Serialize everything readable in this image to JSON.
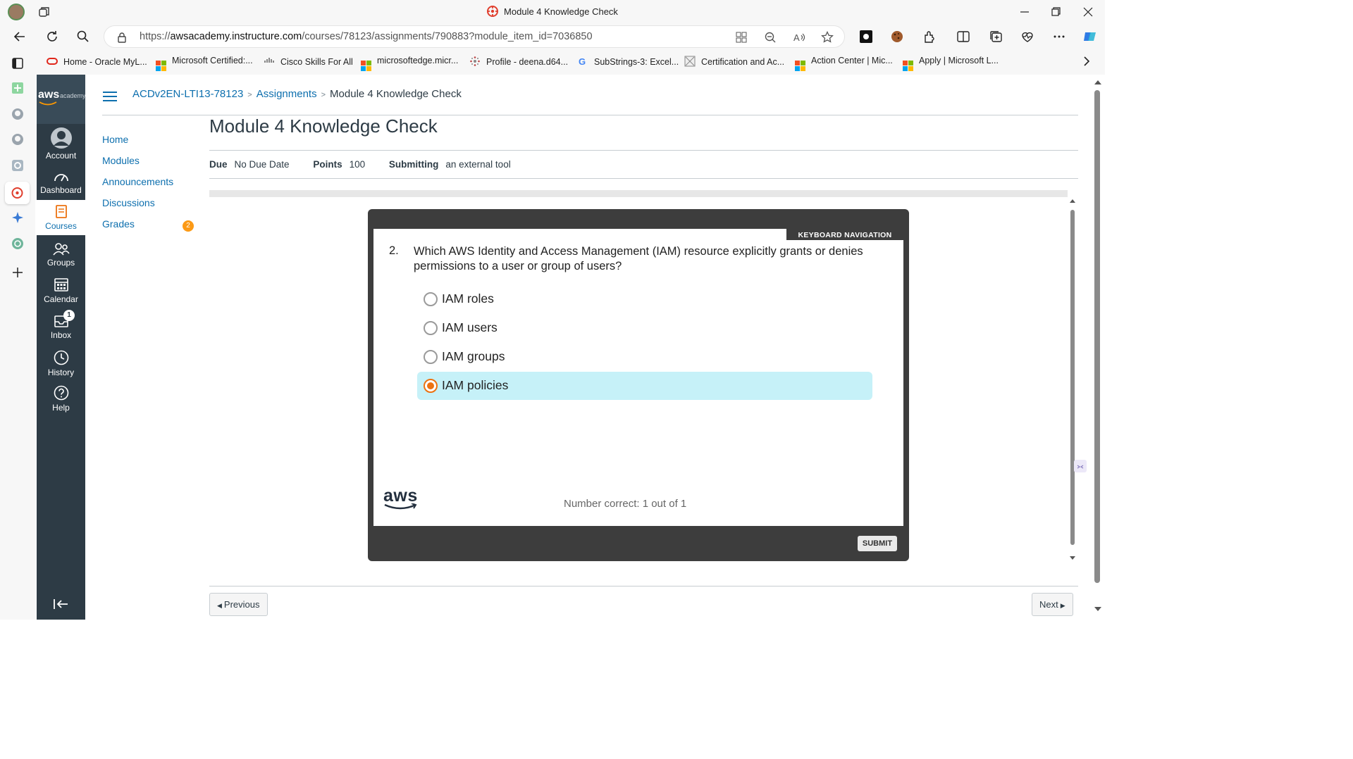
{
  "browser": {
    "window_title": "Module 4 Knowledge Check",
    "url_scheme": "https://",
    "url_host": "awsacademy.instructure.com",
    "url_path": "/courses/78123/assignments/790883?module_item_id=7036850",
    "bookmarks": [
      {
        "label": "Home - Oracle MyL...",
        "icon": "oracle-icon"
      },
      {
        "label": "Microsoft Certified:...",
        "icon": "microsoft-icon"
      },
      {
        "label": "Cisco Skills For All",
        "icon": "cisco-icon"
      },
      {
        "label": "microsoftedge.micr...",
        "icon": "microsoft-icon"
      },
      {
        "label": "Profile - deena.d64...",
        "icon": "profile-icon"
      },
      {
        "label": "SubStrings-3: Excel...",
        "icon": "google-icon"
      },
      {
        "label": "Certification and Ac...",
        "icon": "certification-icon"
      },
      {
        "label": "Action Center | Mic...",
        "icon": "microsoft-icon"
      },
      {
        "label": "Apply | Microsoft L...",
        "icon": "microsoft-icon"
      }
    ]
  },
  "global_nav": {
    "logo_text": "aws",
    "logo_sub": "academy",
    "items": [
      {
        "label": "Account",
        "icon": "account-icon"
      },
      {
        "label": "Dashboard",
        "icon": "dashboard-icon"
      },
      {
        "label": "Courses",
        "icon": "courses-icon",
        "active": true
      },
      {
        "label": "Groups",
        "icon": "groups-icon"
      },
      {
        "label": "Calendar",
        "icon": "calendar-icon"
      },
      {
        "label": "Inbox",
        "icon": "inbox-icon",
        "badge": "1"
      },
      {
        "label": "History",
        "icon": "history-icon"
      },
      {
        "label": "Help",
        "icon": "help-icon"
      }
    ]
  },
  "breadcrumb": {
    "course": "ACDv2EN-LTI13-78123",
    "section": "Assignments",
    "current": "Module 4 Knowledge Check"
  },
  "course_nav": {
    "items": [
      "Home",
      "Modules",
      "Announcements",
      "Discussions",
      "Grades"
    ],
    "grades_badge": "2"
  },
  "assignment": {
    "title": "Module 4 Knowledge Check",
    "due_label": "Due",
    "due_value": "No Due Date",
    "points_label": "Points",
    "points_value": "100",
    "submitting_label": "Submitting",
    "submitting_value": "an external tool"
  },
  "quiz": {
    "keyboard_nav": "KEYBOARD NAVIGATION",
    "question_number": "2.",
    "question_text": "Which AWS Identity and Access Management (IAM) resource explicitly grants or denies permissions to a user or group of users?",
    "options": [
      "IAM roles",
      "IAM users",
      "IAM groups",
      "IAM policies"
    ],
    "selected_option": "IAM policies",
    "score_text": "Number correct: 1 out of 1",
    "logo_text": "aws",
    "submit_label": "SUBMIT"
  },
  "pager": {
    "previous": "Previous",
    "next": "Next"
  },
  "colors": {
    "canvas_nav": "#2d3b45",
    "link": "#0d6fae",
    "aws_orange": "#ec7211",
    "selected_option_bg": "#c6f1f8",
    "grades_badge": "#fc9a16"
  }
}
